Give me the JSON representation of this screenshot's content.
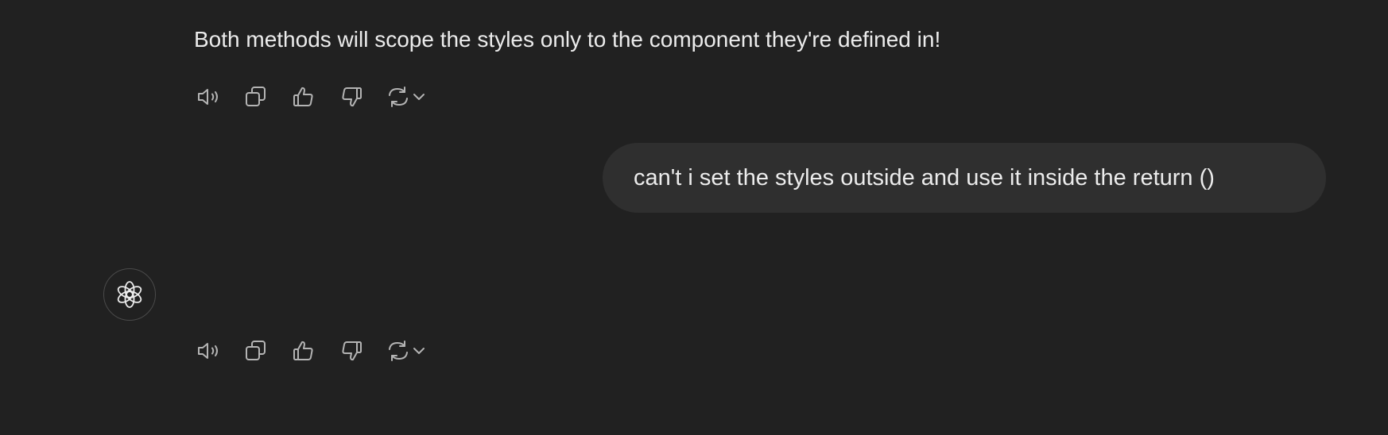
{
  "conversation": {
    "assistant_message_1": {
      "text": "Both methods will scope the styles only to the component they're defined in!",
      "actions": [
        "read-aloud-icon",
        "copy-icon",
        "thumbs-up-icon",
        "thumbs-down-icon",
        "regenerate-icon",
        "chevron-down-icon"
      ]
    },
    "user_message": {
      "text": "can't i set the styles outside and use it inside the return ()"
    },
    "assistant_message_2": {
      "avatar_icon": "openai-logo-icon",
      "text": "",
      "actions": [
        "read-aloud-icon",
        "copy-icon",
        "thumbs-up-icon",
        "thumbs-down-icon",
        "regenerate-icon",
        "chevron-down-icon"
      ]
    }
  },
  "colors": {
    "background": "#212121",
    "user_bubble": "#2f2f2f",
    "text": "#ececec",
    "icon": "#b4b4b4"
  }
}
